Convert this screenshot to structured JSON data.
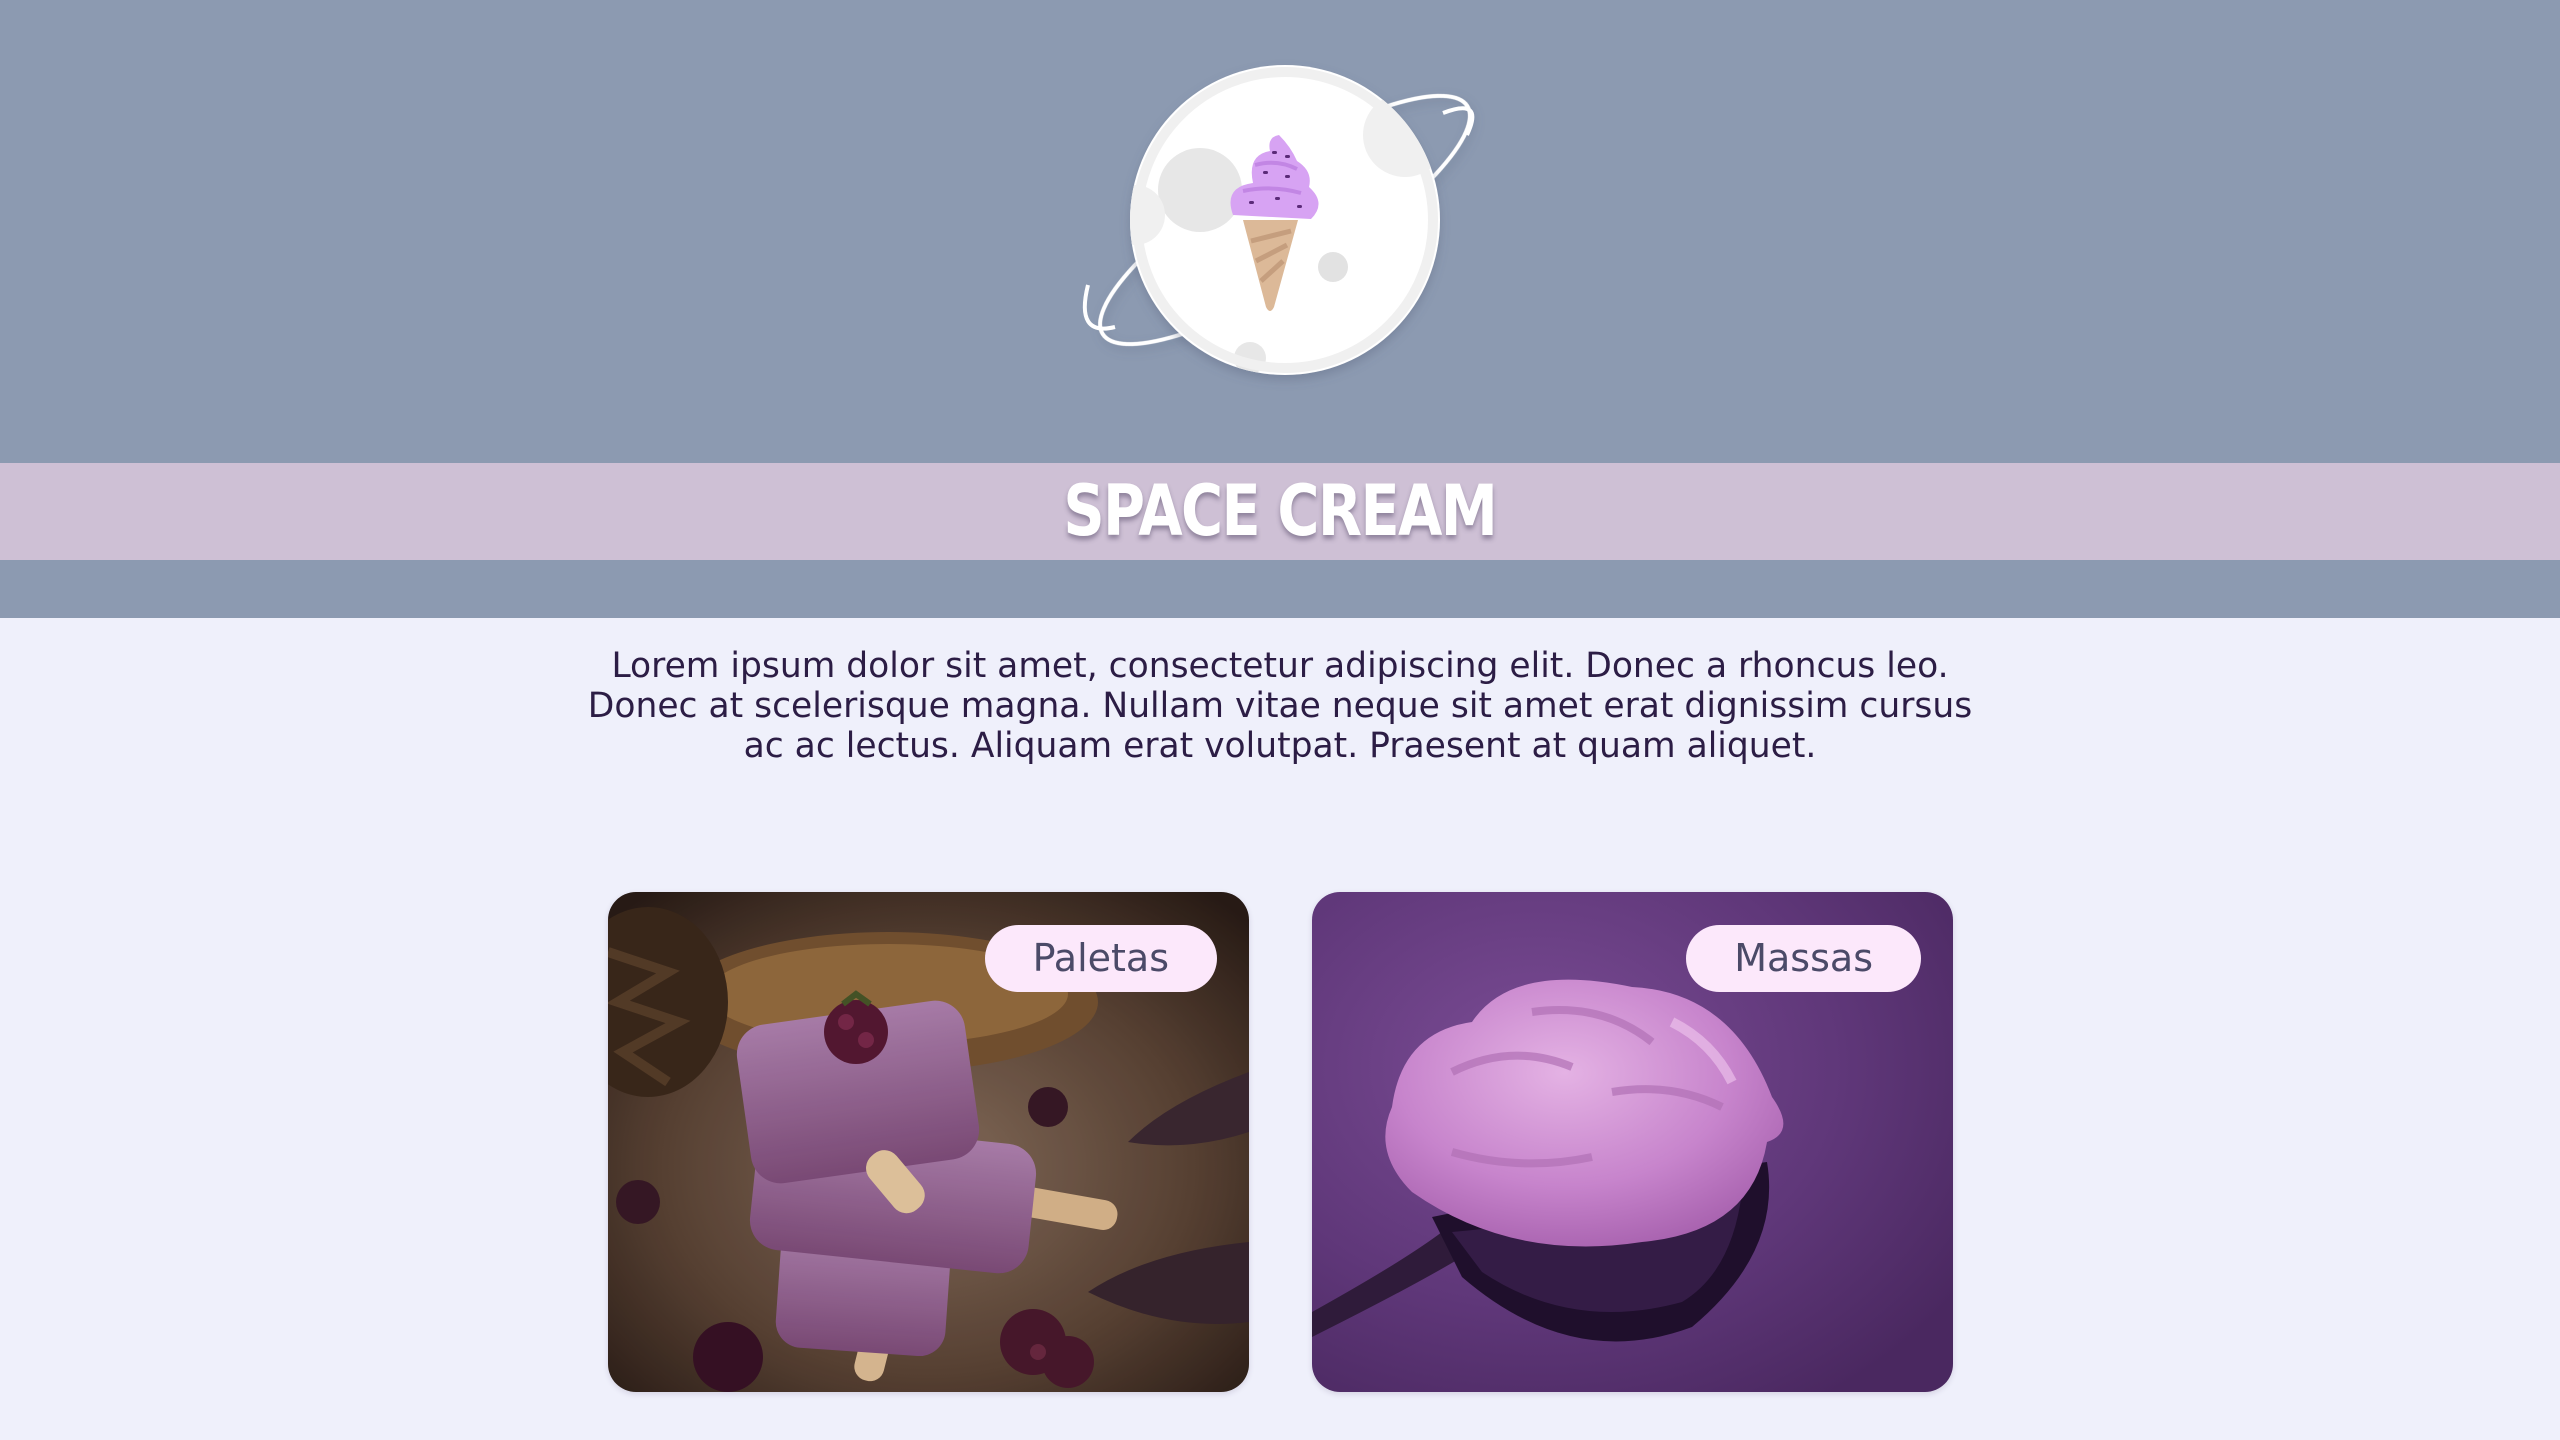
{
  "site": {
    "title": "SPACE CREAM",
    "logo_icon": "ice-cream-planet-icon"
  },
  "intro": {
    "text": "Lorem ipsum dolor sit amet, consectetur adipiscing elit. Donec a rhoncus leo. Donec at scelerisque magna. Nullam vitae neque sit amet erat dignissim cursus ac ac lectus. Aliquam erat volutpat. Praesent at quam aliquet."
  },
  "categories": [
    {
      "label": "Paletas",
      "image": "purple-popsicles-photo"
    },
    {
      "label": "Massas",
      "image": "ice-cream-scoop-photo"
    }
  ],
  "colors": {
    "header_bg": "#8c9ab1",
    "title_band": "#cec0d5",
    "page_bg": "#eff0fb",
    "text": "#2c1d45",
    "label_bg": "#fce8fb",
    "label_text": "#4b4a68",
    "ice_cream": "#d7a3f3"
  }
}
